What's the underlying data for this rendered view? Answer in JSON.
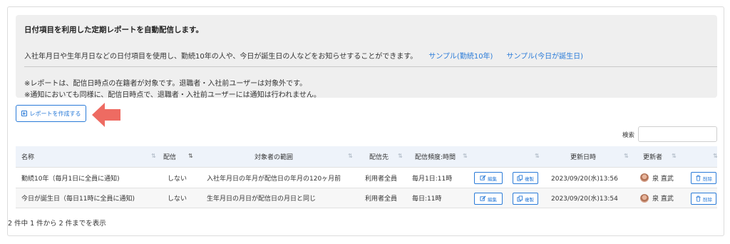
{
  "info": {
    "title": "日付項目を利用した定期レポートを自動配信します。",
    "description": "入社年月日や生年月日などの日付項目を使用し、勤続10年の人や、今日が誕生日の人などをお知らせすることができます。",
    "link1": "サンプル(勤続10年)",
    "link2": "サンプル(今日が誕生日)",
    "note1": "※レポートは、配信日時点の在籍者が対象です。退職者・入社前ユーザーは対象外です。",
    "note2": "※通知においても同様に、配信日時点で、退職者・入社前ユーザーには通知は行われません。"
  },
  "create_button": "レポートを作成する",
  "search": {
    "label": "検索",
    "value": ""
  },
  "table": {
    "headers": {
      "name": "名称",
      "delivery": "配信",
      "scope": "対象者の範囲",
      "recipient": "配信先",
      "frequency": "配信頻度:時間",
      "updated_at": "更新日時",
      "updated_by": "更新者"
    },
    "sort_icon": "⇅",
    "rows": [
      {
        "name": "勤続10年（毎月1日に全員に通知)",
        "delivery": "しない",
        "scope": "入社年月日の年月が配信日の年月の120ヶ月前",
        "recipient": "利用者全員",
        "frequency": "毎月1日:11時",
        "edit": "編集",
        "copy": "複製",
        "updated_at": "2023/09/20(水)13:56",
        "updated_by": "泉 直武",
        "delete": "削除"
      },
      {
        "name": "今日が誕生日（毎日11時に全員に通知)",
        "delivery": "しない",
        "scope": "生年月日の月日が配信日の月日と同じ",
        "recipient": "利用者全員",
        "frequency": "毎日:11時",
        "edit": "編集",
        "copy": "複製",
        "updated_at": "2023/09/20(水)13:54",
        "updated_by": "泉 直武",
        "delete": "削除"
      }
    ]
  },
  "footer": "2 件中 1 件から 2 件までを表示",
  "colors": {
    "accent": "#2a7bd8",
    "arrow": "#ee6b62",
    "header_bg": "#eef3fa",
    "info_bg": "#efefef"
  },
  "icons": [
    "plus-square-icon",
    "arrow-left-icon",
    "edit-icon",
    "copy-icon",
    "trash-icon",
    "sort-icon"
  ]
}
